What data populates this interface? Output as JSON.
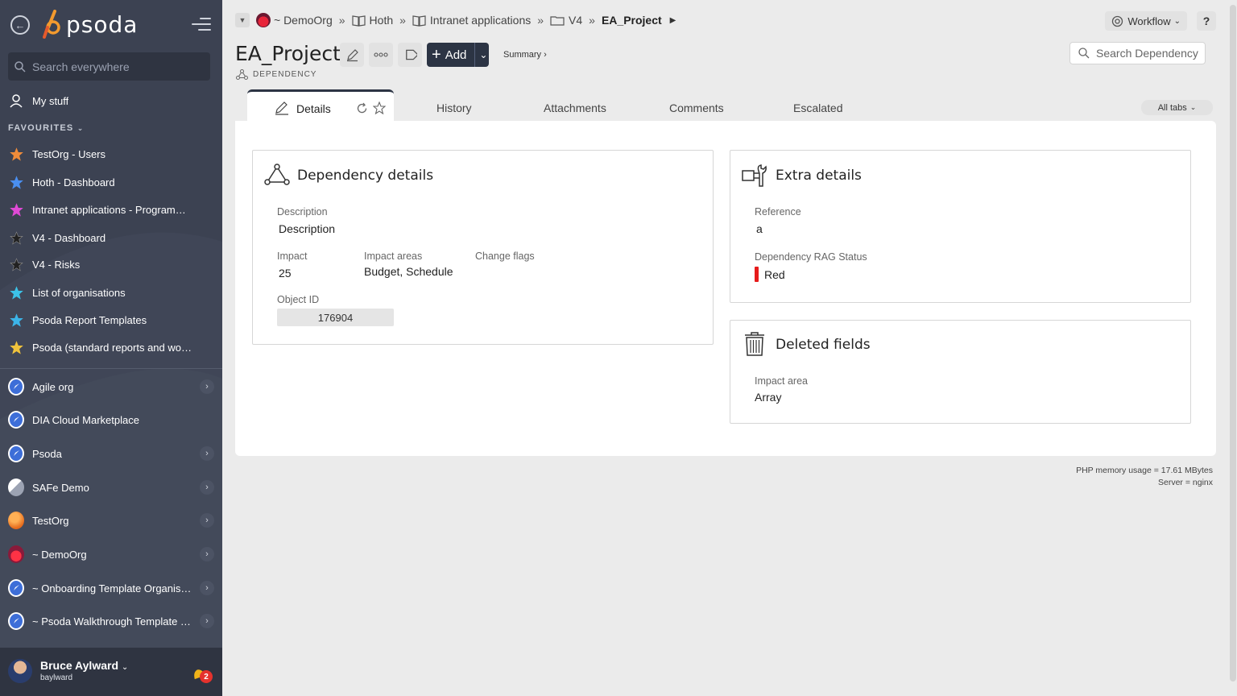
{
  "sidebar": {
    "logo_text": "psoda",
    "search_placeholder": "Search everywhere",
    "my_stuff": "My stuff",
    "favourites_heading": "FAVOURITES",
    "favourites": [
      {
        "label": "TestOrg - Users",
        "color": "#f08c3a"
      },
      {
        "label": "Hoth - Dashboard",
        "color": "#4a8ff0"
      },
      {
        "label": "Intranet applications - Programme...",
        "color": "#e04ad6"
      },
      {
        "label": "V4 - Dashboard",
        "color": "#222222"
      },
      {
        "label": "V4 - Risks",
        "color": "#222222"
      },
      {
        "label": "List of organisations",
        "color": "#3cc2e8"
      },
      {
        "label": "Psoda Report Templates",
        "color": "#3cb4e8"
      },
      {
        "label": "Psoda (standard reports and work...",
        "color": "#f0c33c"
      }
    ],
    "orgs": [
      {
        "label": "Agile org",
        "icon": "compass-icon",
        "chevron": true
      },
      {
        "label": "DIA Cloud Marketplace",
        "icon": "compass-icon",
        "chevron": false
      },
      {
        "label": "Psoda",
        "icon": "compass-icon",
        "chevron": true
      },
      {
        "label": "SAFe Demo",
        "icon": "safe-demo-icon",
        "chevron": true
      },
      {
        "label": "TestOrg",
        "icon": "orange-ball-icon",
        "chevron": true
      },
      {
        "label": "~ DemoOrg",
        "icon": "sunset-icon",
        "chevron": true
      },
      {
        "label": "~ Onboarding Template Organisa...",
        "icon": "compass-icon",
        "chevron": true
      },
      {
        "label": "~ Psoda Walkthrough Template P...",
        "icon": "compass-icon",
        "chevron": true
      }
    ],
    "user": {
      "name": "Bruce Aylward",
      "login": "baylward",
      "notifications": "2"
    }
  },
  "breadcrumb": [
    {
      "label": "~ DemoOrg",
      "icon": "demoorg-icon"
    },
    {
      "label": "Hoth",
      "icon": "book-icon"
    },
    {
      "label": "Intranet applications",
      "icon": "book-icon"
    },
    {
      "label": "V4",
      "icon": "folder-icon"
    },
    {
      "label": "EA_Project",
      "icon": ""
    }
  ],
  "header": {
    "workflow_label": "Workflow",
    "help_label": "?",
    "title": "EA_Project",
    "object_type": "DEPENDENCY",
    "add_label": "Add",
    "summary_label": "Summary ›",
    "search_placeholder": "Search Dependency"
  },
  "tabs": {
    "active": "Details",
    "items": [
      "History",
      "Attachments",
      "Comments",
      "Escalated"
    ],
    "all_tabs_label": "All tabs"
  },
  "dependency_details": {
    "title": "Dependency details",
    "description_label": "Description",
    "description_value": "Description",
    "impact_label": "Impact",
    "impact_value": "25",
    "impact_areas_label": "Impact areas",
    "impact_areas_value": "Budget, Schedule",
    "change_flags_label": "Change flags",
    "object_id_label": "Object ID",
    "object_id_value": "176904"
  },
  "extra_details": {
    "title": "Extra details",
    "reference_label": "Reference",
    "reference_value": "a",
    "rag_label": "Dependency RAG Status",
    "rag_value": "Red",
    "rag_color": "#e61b1b"
  },
  "deleted_fields": {
    "title": "Deleted fields",
    "impact_area_label": "Impact area",
    "impact_area_value": "Array"
  },
  "footer": {
    "memory": "PHP memory usage = 17.61 MBytes",
    "server": "Server = nginx"
  }
}
